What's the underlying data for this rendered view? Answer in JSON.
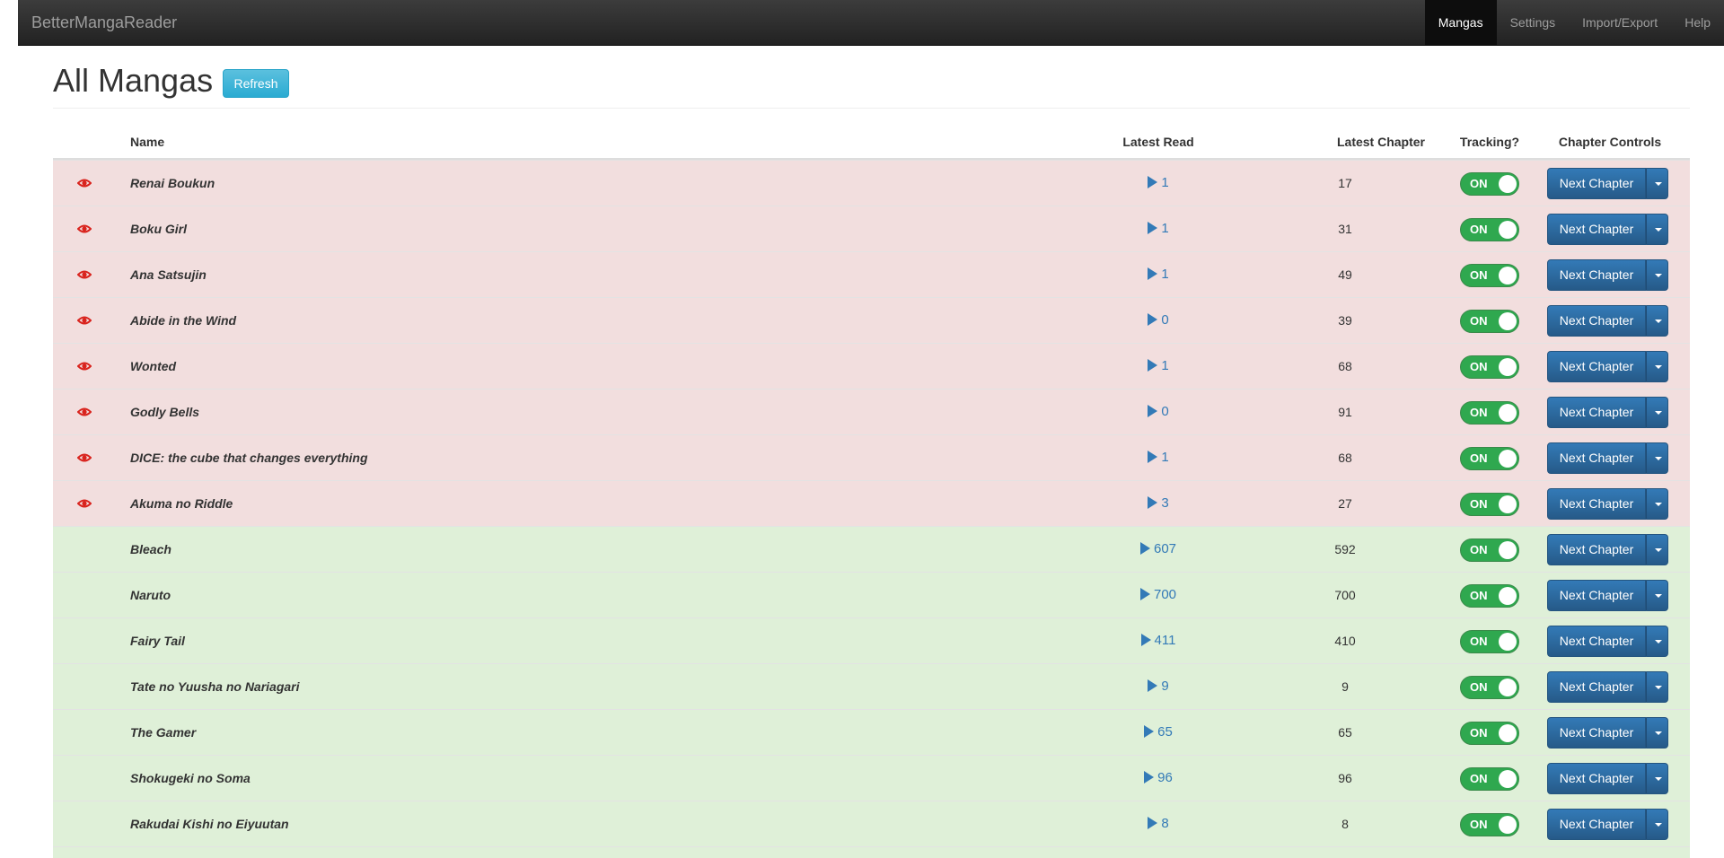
{
  "navbar": {
    "brand": "BetterMangaReader",
    "links": [
      "Mangas",
      "Settings",
      "Import/Export",
      "Help"
    ],
    "active": "Mangas"
  },
  "page": {
    "title": "All Mangas",
    "refresh_label": "Refresh"
  },
  "table": {
    "headers": {
      "name": "Name",
      "latest_read": "Latest Read",
      "latest_chapter": "Latest Chapter",
      "tracking": "Tracking?",
      "controls": "Chapter Controls"
    },
    "toggle_label": "ON",
    "next_label": "Next Chapter",
    "rows": [
      {
        "name": "Renai Boukun",
        "latest_read": "1",
        "latest_chapter": "17",
        "status": "unread"
      },
      {
        "name": "Boku Girl",
        "latest_read": "1",
        "latest_chapter": "31",
        "status": "unread"
      },
      {
        "name": "Ana Satsujin",
        "latest_read": "1",
        "latest_chapter": "49",
        "status": "unread"
      },
      {
        "name": "Abide in the Wind",
        "latest_read": "0",
        "latest_chapter": "39",
        "status": "unread"
      },
      {
        "name": "Wonted",
        "latest_read": "1",
        "latest_chapter": "68",
        "status": "unread"
      },
      {
        "name": "Godly Bells",
        "latest_read": "0",
        "latest_chapter": "91",
        "status": "unread"
      },
      {
        "name": "DICE: the cube that changes everything",
        "latest_read": "1",
        "latest_chapter": "68",
        "status": "unread"
      },
      {
        "name": "Akuma no Riddle",
        "latest_read": "3",
        "latest_chapter": "27",
        "status": "unread"
      },
      {
        "name": "Bleach",
        "latest_read": "607",
        "latest_chapter": "592",
        "status": "read"
      },
      {
        "name": "Naruto",
        "latest_read": "700",
        "latest_chapter": "700",
        "status": "read"
      },
      {
        "name": "Fairy Tail",
        "latest_read": "411",
        "latest_chapter": "410",
        "status": "read"
      },
      {
        "name": "Tate no Yuusha no Nariagari",
        "latest_read": "9",
        "latest_chapter": "9",
        "status": "read"
      },
      {
        "name": "The Gamer",
        "latest_read": "65",
        "latest_chapter": "65",
        "status": "read"
      },
      {
        "name": "Shokugeki no Soma",
        "latest_read": "96",
        "latest_chapter": "96",
        "status": "read"
      },
      {
        "name": "Rakudai Kishi no Eiyuutan",
        "latest_read": "8",
        "latest_chapter": "8",
        "status": "read"
      }
    ]
  },
  "icons": {
    "unread_indicator": "eye-icon",
    "read_arrow": "play-icon",
    "dropdown": "caret-down-icon"
  },
  "colors": {
    "unread_row": "#f2dede",
    "read_row": "#dff0d8",
    "toggle_on": "#2fa84f",
    "primary": "#337ab7",
    "info": "#5bc0de",
    "eye": "#d9231d"
  }
}
